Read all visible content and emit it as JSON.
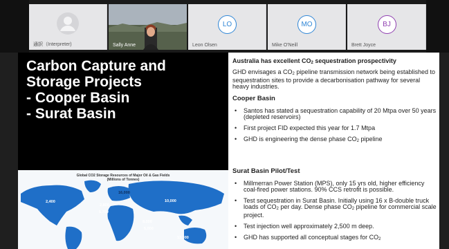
{
  "participants": [
    {
      "name": "通訳（Interpreter)",
      "kind": "avatar"
    },
    {
      "name": "Sally Anne",
      "kind": "video"
    },
    {
      "name": "Leon Olsen",
      "initials": "LO",
      "color": "#2f86d6"
    },
    {
      "name": "Mike O'Neill",
      "initials": "MO",
      "color": "#2f86d6"
    },
    {
      "name": "Brett Joyce",
      "initials": "BJ",
      "color": "#8f3fb0"
    }
  ],
  "slide": {
    "title": "Carbon Capture and\nStorage Projects\n- Cooper Basin\n- Surat Basin",
    "heading_pre": "Australia has excellent CO",
    "heading_sub": "2",
    "heading_post": " sequestration prospectivity",
    "intro_pre": "GHD envisages a CO",
    "intro_sub": "2",
    "intro_post": " pipeline transmission network being established to sequestration sites to provide a decarbonisation pathway for several heavy industries.",
    "cooper_heading": "Cooper Basin",
    "cooper_1": "Santos has stated a sequestration capability of 20 Mtpa over 50 years (depleted reservoirs)",
    "cooper_2": "First project FID expected this year for 1.7 Mtpa",
    "cooper_3_pre": "GHD is engineering the dense phase CO",
    "cooper_3_sub": "2",
    "cooper_3_post": " pipeline",
    "surat_heading": "Surat Basin Pilot/Test",
    "surat_1": "Millmerran Power Station (MPS), only 15 yrs old, higher efficiency coal-fired power stations. 90% CCS retrofit is possible.",
    "surat_2_a": "Test sequestration in Surat Basin. Initially using 16 x B-double truck loads of CO",
    "surat_2_sub": "2",
    "surat_2_b": " per day. Dense phase CO",
    "surat_2_sub2": "2",
    "surat_2_c": " pipeline for commercial scale project.",
    "surat_3": "Test injection well approximately 2,500 m deep.",
    "surat_4_pre": "GHD has supported all conceptual stages for CO",
    "surat_4_sub": "2"
  },
  "map": {
    "title": "Global CO2 Storage Resources of Major Oil & Gas Fields\n(Millions of Tonnes)",
    "values": [
      "16,000",
      "2,400",
      "2,800",
      "5,700",
      "10,000",
      "8,000",
      "5,000",
      "13,300"
    ]
  }
}
